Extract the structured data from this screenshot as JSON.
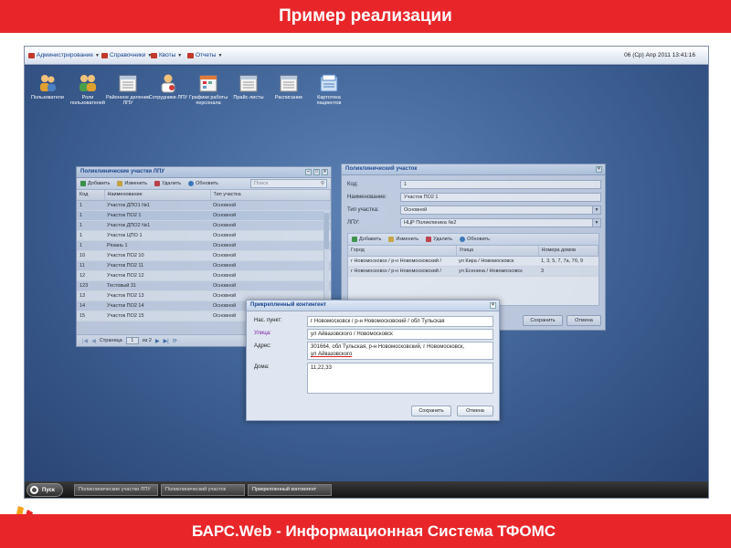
{
  "header": {
    "title": "Пример реализации"
  },
  "footer": {
    "text": "БАРС.Web - Информационная Система ТФОМС"
  },
  "menubar": {
    "items": [
      "Администрирование",
      "Справочники",
      "Квоты",
      "Отчеты"
    ],
    "datetime": "06 (Ср) Апр 2011 13:41:16"
  },
  "desktop_icons": [
    {
      "label": "Пользователи",
      "icon": "users-icon"
    },
    {
      "label": "Роли пользователей",
      "icon": "roles-icon"
    },
    {
      "label": "Районное деление ЛПУ",
      "icon": "calendar-icon"
    },
    {
      "label": "Сотрудники ЛПУ",
      "icon": "doctor-icon"
    },
    {
      "label": "Графики работы персонала",
      "icon": "schedule-icon"
    },
    {
      "label": "Прайс-листы",
      "icon": "pricelist-icon"
    },
    {
      "label": "Расписание",
      "icon": "timetable-icon"
    },
    {
      "label": "Картотека пациентов",
      "icon": "card-index-icon"
    }
  ],
  "list_window": {
    "title": "Поликлинические участки ЛПУ",
    "toolbar": {
      "add": "Добавить",
      "edit": "Изменить",
      "delete": "Удалить",
      "refresh": "Обновить",
      "search_placeholder": "Поиск"
    },
    "columns": [
      "Код",
      "Наименование",
      "Тип участка"
    ],
    "rows": [
      [
        "1",
        "Участок ДПО1 №1",
        "Основной"
      ],
      [
        "1",
        "Участок ПО2 1",
        "Основной"
      ],
      [
        "1",
        "Участок ДПО2 №1",
        "Основной"
      ],
      [
        "1",
        "Участок ЦПО 1",
        "Основной"
      ],
      [
        "1",
        "Рязань 1",
        "Основной"
      ],
      [
        "10",
        "Участок ПО2 10",
        "Основной"
      ],
      [
        "11",
        "Участок ПО2 11",
        "Основной"
      ],
      [
        "12",
        "Участок ПО2 12",
        "Основной"
      ],
      [
        "123",
        "Тестовый 31",
        "Основной"
      ],
      [
        "13",
        "Участок ПО2 13",
        "Основной"
      ],
      [
        "14",
        "Участок ПО2 14",
        "Основной"
      ],
      [
        "15",
        "Участок ПО2 15",
        "Основной"
      ]
    ],
    "pager": {
      "page_label": "Страница",
      "page": "1",
      "of_label": "из 2"
    }
  },
  "detail_window": {
    "title": "Поликлинический участок",
    "labels": {
      "code": "Код:",
      "name": "Наименование:",
      "type": "Тип участка:",
      "lpu": "ЛПУ:"
    },
    "values": {
      "code": "1",
      "name": "Участок ПО2 1",
      "type": "Основной",
      "lpu": "НЦР Поликлиника №2"
    },
    "toolbar": {
      "add": "Добавить",
      "edit": "Изменить",
      "delete": "Удалить",
      "refresh": "Обновить"
    },
    "columns": [
      "Город",
      "Улица",
      "Номера домов"
    ],
    "rows": [
      [
        "г Новомосковск / р-н Новомосковский /",
        "ул Кира / Новомосковск",
        "1, 3, 5, 7, 7а, 7б, 9"
      ],
      [
        "г Новомосковск / р-н Новомосковский /",
        "ул Есенина / Новомосковск",
        "3"
      ]
    ],
    "buttons": {
      "save": "Сохранить",
      "cancel": "Отмена"
    }
  },
  "dialog": {
    "title": "Прикрепленный контингент",
    "labels": {
      "locality": "Нас. пункт:",
      "street": "Улица:",
      "address": "Адрес:",
      "houses": "Дома:"
    },
    "values": {
      "locality": "г Новомосковск / р-н Новомосковский / обл Тульская",
      "street": "ул Айвазовского / Новомосковск",
      "address_line1": "301664, обл Тульская, р-н Новомосковский, г Новомосковск,",
      "address_line2": "ул Айвазовского",
      "houses": "11,22,33"
    },
    "buttons": {
      "save": "Сохранить",
      "cancel": "Отмена"
    }
  },
  "taskbar": {
    "start": "Пуск",
    "tasks": [
      "Поликлинические участки ЛПУ",
      "Поликлинический участок",
      "Прикрепленный контингент"
    ]
  },
  "colors": {
    "brand_red": "#e8262a",
    "desktop_blue": "#3d5f92",
    "title_blue": "#15428b"
  }
}
